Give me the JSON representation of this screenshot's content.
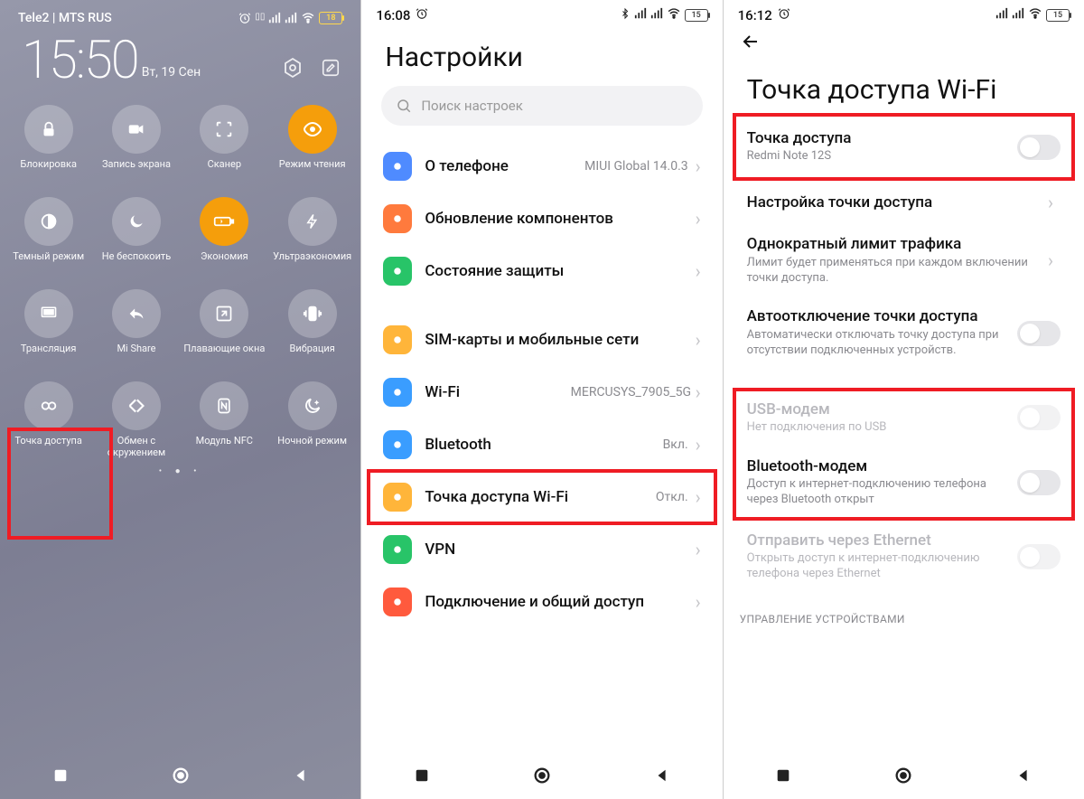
{
  "screen1": {
    "carrier": "Tele2 | MTS RUS",
    "battery": "18",
    "time": "15:50",
    "date": "Вт, 19 Сен",
    "tiles": [
      {
        "icon": "lock",
        "label": "Блокировка",
        "active": false
      },
      {
        "icon": "video",
        "label": "Запись экрана",
        "active": false
      },
      {
        "icon": "scan",
        "label": "Сканер",
        "active": false
      },
      {
        "icon": "eye",
        "label": "Режим чтения",
        "active": true
      },
      {
        "icon": "contrast",
        "label": "Темный режим",
        "active": false
      },
      {
        "icon": "moon",
        "label": "Не беспокоить",
        "active": false
      },
      {
        "icon": "battery",
        "label": "Экономия",
        "active": true
      },
      {
        "icon": "bolt",
        "label": "Ультраэкономия",
        "active": false
      },
      {
        "icon": "cast",
        "label": "Трансляция",
        "active": false
      },
      {
        "icon": "mishare",
        "label": "Mi Share",
        "active": false
      },
      {
        "icon": "floatwin",
        "label": "Плавающие окна",
        "active": false
      },
      {
        "icon": "vibrate",
        "label": "Вибрация",
        "active": false
      },
      {
        "icon": "hotspot",
        "label": "Точка доступа",
        "active": false
      },
      {
        "icon": "envshare",
        "label": "Обмен с окружением",
        "active": false
      },
      {
        "icon": "nfc",
        "label": "Модуль NFC",
        "active": false
      },
      {
        "icon": "night",
        "label": "Ночной режим",
        "active": false
      }
    ]
  },
  "screen2": {
    "time": "16:08",
    "battery": "15",
    "title": "Настройки",
    "search_placeholder": "Поиск настроек",
    "group1": [
      {
        "color": "#4f8bff",
        "title": "О телефоне",
        "value": "MIUI Global 14.0.3"
      },
      {
        "color": "#ff7a3d",
        "title": "Обновление компонентов",
        "value": ""
      },
      {
        "color": "#28c468",
        "title": "Состояние защиты",
        "value": ""
      }
    ],
    "group2": [
      {
        "color": "#ffb53a",
        "title": "SIM-карты и мобильные сети",
        "value": ""
      },
      {
        "color": "#3a9dff",
        "title": "Wi-Fi",
        "value": "MERCUSYS_7905_5G"
      },
      {
        "color": "#3a9dff",
        "title": "Bluetooth",
        "value": "Вкл."
      },
      {
        "color": "#ffb53a",
        "title": "Точка доступа Wi-Fi",
        "value": "Откл.",
        "hl": true
      },
      {
        "color": "#28c468",
        "title": "VPN",
        "value": ""
      },
      {
        "color": "#ff5a3d",
        "title": "Подключение и общий доступ",
        "value": ""
      }
    ]
  },
  "screen3": {
    "time": "16:12",
    "battery": "15",
    "title": "Точка доступа Wi-Fi",
    "items": [
      {
        "title": "Точка доступа",
        "sub": "Redmi Note 12S",
        "ctrl": "toggle",
        "hl": true
      },
      {
        "title": "Настройка точки доступа",
        "sub": "",
        "ctrl": "chev"
      },
      {
        "title": "Однократный лимит трафика",
        "sub": "Лимит будет применяться при каждом включении точки доступа.",
        "ctrl": "chev"
      },
      {
        "title": "Автоотключение точки доступа",
        "sub": "Автоматически отключать точку доступа при отсутствии подключенных устройств.",
        "ctrl": "toggle"
      },
      {
        "title": "USB-модем",
        "sub": "Нет подключения по USB",
        "ctrl": "toggle",
        "disabled": true,
        "hl_group": true
      },
      {
        "title": "Bluetooth-модем",
        "sub": "Доступ к интернет-подключению телефона через Bluetooth открыт",
        "ctrl": "toggle",
        "hl_group": true
      },
      {
        "title": "Отправить через Ethernet",
        "sub": "Открыть доступ к интернет-подключению телефона через Ethernet",
        "ctrl": "toggle",
        "disabled": true
      }
    ],
    "section_label": "УПРАВЛЕНИЕ УСТРОЙСТВАМИ"
  }
}
